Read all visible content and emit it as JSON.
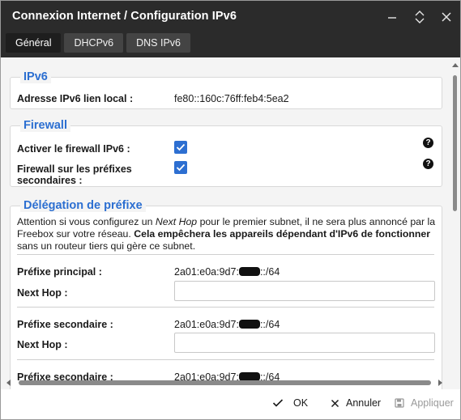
{
  "window": {
    "title": "Connexion Internet / Configuration IPv6"
  },
  "tabs": [
    {
      "label": "Général"
    },
    {
      "label": "DHCPv6"
    },
    {
      "label": "DNS IPv6"
    }
  ],
  "ipv6": {
    "legend": "IPv6",
    "local_address_label": "Adresse IPv6 lien local :",
    "local_address_value": "fe80::160c:76ff:feb4:5ea2"
  },
  "firewall": {
    "legend": "Firewall",
    "enable_label": "Activer le firewall IPv6 :",
    "enable_checked": true,
    "secondary_label": "Firewall sur les préfixes secondaires :",
    "secondary_checked": true,
    "help": "?"
  },
  "delegation": {
    "legend": "Délégation de préfixe",
    "notice_1": "Attention si vous configurez un ",
    "notice_em": "Next Hop",
    "notice_2": " pour le premier subnet, il ne sera plus annoncé par la Freebox sur votre réseau. ",
    "notice_bold": "Cela empêchera les appareils dépendant d'IPv6 de fonctionner",
    "notice_3": " sans un routeur tiers qui gère ce subnet.",
    "primary_label": "Préfixe principal :",
    "primary_prefix_start": "2a01:e0a:9d7:",
    "primary_prefix_end": "::/64",
    "next_hop_label": "Next Hop :",
    "next_hop_value": "",
    "secondary_label": "Préfixe secondaire :",
    "secondary_prefix_start": "2a01:e0a:9d7:",
    "secondary_prefix_end": "::/64",
    "next_hop_label_2": "Next Hop :",
    "next_hop_value_2": "",
    "secondary_label_2": "Préfixe secondaire :",
    "secondary_prefix_start_2": "2a01:e0a:9d7:",
    "secondary_prefix_end_2": "::/64"
  },
  "footer": {
    "ok_label": "OK",
    "cancel_label": "Annuler",
    "apply_label": "Appliquer"
  },
  "colors": {
    "titlebar": "#2b2b2b",
    "accent": "#2c6fd1",
    "checkbox": "#2d6fd1"
  }
}
